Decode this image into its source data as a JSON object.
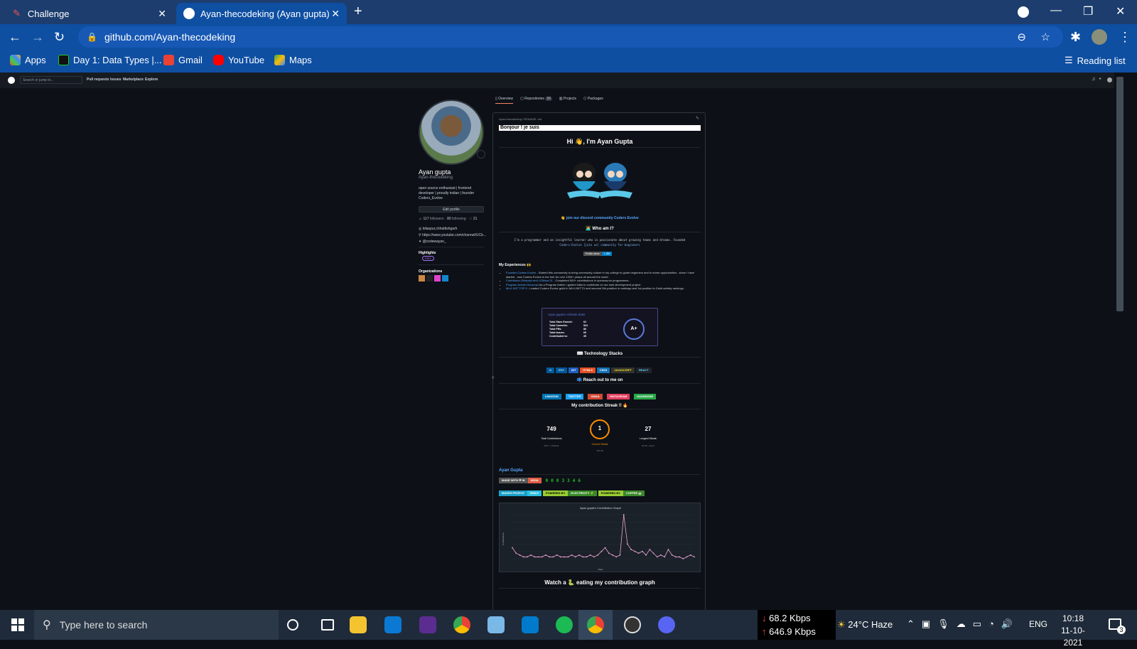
{
  "browser": {
    "tabs": [
      {
        "title": "Challenge",
        "close": "✕"
      },
      {
        "title": "Ayan-thecodeking (Ayan gupta)",
        "close": "✕"
      }
    ],
    "url": "github.com/Ayan-thecodeking",
    "bookmarks": [
      "Apps",
      "Day 1: Data Types |...",
      "Gmail",
      "YouTube",
      "Maps"
    ],
    "reading_list": "Reading list"
  },
  "github": {
    "header": {
      "search_placeholder": "Search or jump to...",
      "nav": [
        "Pull requests",
        "Issues",
        "Marketplace",
        "Explore"
      ]
    },
    "profile": {
      "name": "Ayan gupta",
      "username": "Ayan-thecodeking",
      "bio": "open source enthusiast | frontend developer | proudly indian | founder Coders_Evolve",
      "edit_button": "Edit profile",
      "followers": "117",
      "followers_label": "followers",
      "following": "80",
      "following_label": "following",
      "stars": "21",
      "location": "bilaspur,chhattishgarh",
      "website": "https://www.youtube.com/channel/UCb...",
      "twitter": "@codewayan_",
      "highlights_title": "Highlights",
      "pro_badge": "PRO",
      "orgs_title": "Organizations"
    },
    "tabs": [
      "Overview",
      "Repositories",
      "Projects",
      "Packages"
    ],
    "repo_count": "39",
    "readme": {
      "path": "Ayan-thecodeking / README .md",
      "bonjour": "Bonjour ! je suis",
      "hi": "Hi 👋, I'm Ayan Gupta",
      "discord_link": "👋 join our discord community Coders Evolve",
      "who": "🧑‍💻 Who am I?",
      "who_text": "I'm a programmer and an insightful learner who is passionate about growing teams and dreams. Founded",
      "who_text2": "Coders-Evolve [join us] community for beginners",
      "profile_views": "Profile views",
      "profile_views_count": "1,386",
      "exp_title": "My Experiences 🙌",
      "experiences": [
        {
          "link": "Founder-Coders Evolve",
          "text": " - Started this community to bring community culture in my college to guide beginners and to share opportunities ..since I have started , now Coders Evolve is the hub for over 1300+ peeps all around the world ."
        },
        {
          "link": "Contributor-Girlscript and LGMsoc'21",
          "text": " - Completed 500+ contributions in opensource programmes ."
        },
        {
          "link": "Program-Admin Devscript",
          "text": " As a Program Admin I guided folks to contribute on our web development project ."
        },
        {
          "link": "MLH-INIT TOP 5",
          "text": " - Leaded Coders Evolve guild in MLH-INIT'21 and secured 5th position in rankings and 1st position in Guild activity rankings ."
        }
      ],
      "stats": {
        "title": "Ayan gupta's GitHub Stats",
        "rows": [
          [
            "Total Stars Earned:",
            "62"
          ],
          [
            "Total Commits:",
            "524"
          ],
          [
            "Total PRs:",
            "86"
          ],
          [
            "Total Issues:",
            "69"
          ],
          [
            "Contributed to:",
            "35"
          ]
        ],
        "grade": "A+"
      },
      "tech_title": "⌨ Technology Stacks",
      "tech": [
        "C",
        "C++",
        "GIT",
        "HTML5",
        "CSS3",
        "JAVASCRIPT",
        "REACT"
      ],
      "reach_title": "📫 Reach out to me on",
      "social": [
        "LINKEDIN",
        "TWITTER",
        "GMAIL",
        "INSTAGRAM",
        "HASHNODE"
      ],
      "streak_title": "My contribution Streak !! 🔥",
      "streak": {
        "total": "749",
        "total_label": "Total Contributions",
        "total_range": "Feb 7 - Present",
        "current": "1",
        "current_label": "Current Streak",
        "current_range": "Oct 10",
        "longest": "27",
        "longest_label": "Longest Streak",
        "longest_range": "Jul 12 - Aug 7"
      },
      "ayan_link": "Ayan Gupta",
      "made_with": "MADE WITH ❤ IN",
      "india": "INDIA",
      "counter": [
        "0",
        "0",
        "0",
        "3",
        "3",
        "4",
        "6"
      ],
      "badges2": [
        [
          "MAKES PEOPLE",
          "SMILE"
        ],
        [
          "POWERED BY",
          "ELECTRICITY ⚡"
        ],
        [
          "POWERED BY",
          "COFFEE ☕"
        ]
      ],
      "graph_title": "Ayan gupta's Contribution Graph",
      "graph_ylabel": "Contributions",
      "graph_xlabel": "Days",
      "watch": "Watch a 🐍 eating my contribution graph"
    }
  },
  "chart_data": {
    "type": "line",
    "title": "Ayan gupta's Contribution Graph",
    "ylabel": "Contributions",
    "xlabel": "Days",
    "values": [
      6,
      3,
      2,
      1,
      1,
      2,
      1,
      1,
      1,
      2,
      1,
      1,
      2,
      1,
      1,
      1,
      2,
      1,
      2,
      1,
      1,
      2,
      1,
      2,
      4,
      6,
      3,
      2,
      1,
      2,
      24,
      8,
      5,
      4,
      3,
      4,
      2,
      5,
      3,
      1,
      2,
      1,
      5,
      2,
      1,
      1,
      0,
      1,
      2,
      1
    ]
  },
  "taskbar": {
    "search_placeholder": "Type here to search",
    "net_down": "68.2 Kbps",
    "net_up": "646.9 Kbps",
    "weather": "24°C  Haze",
    "lang": "ENG",
    "time": "10:18",
    "date": "11-10-2021",
    "notif": "3"
  },
  "colors": {
    "tabbar": "#1c3d6e",
    "chrome": "#0e4fa2",
    "gh_bg": "#0d1117",
    "link": "#58a6ff",
    "accent": "#f78166",
    "streak": "#fb8c00"
  }
}
